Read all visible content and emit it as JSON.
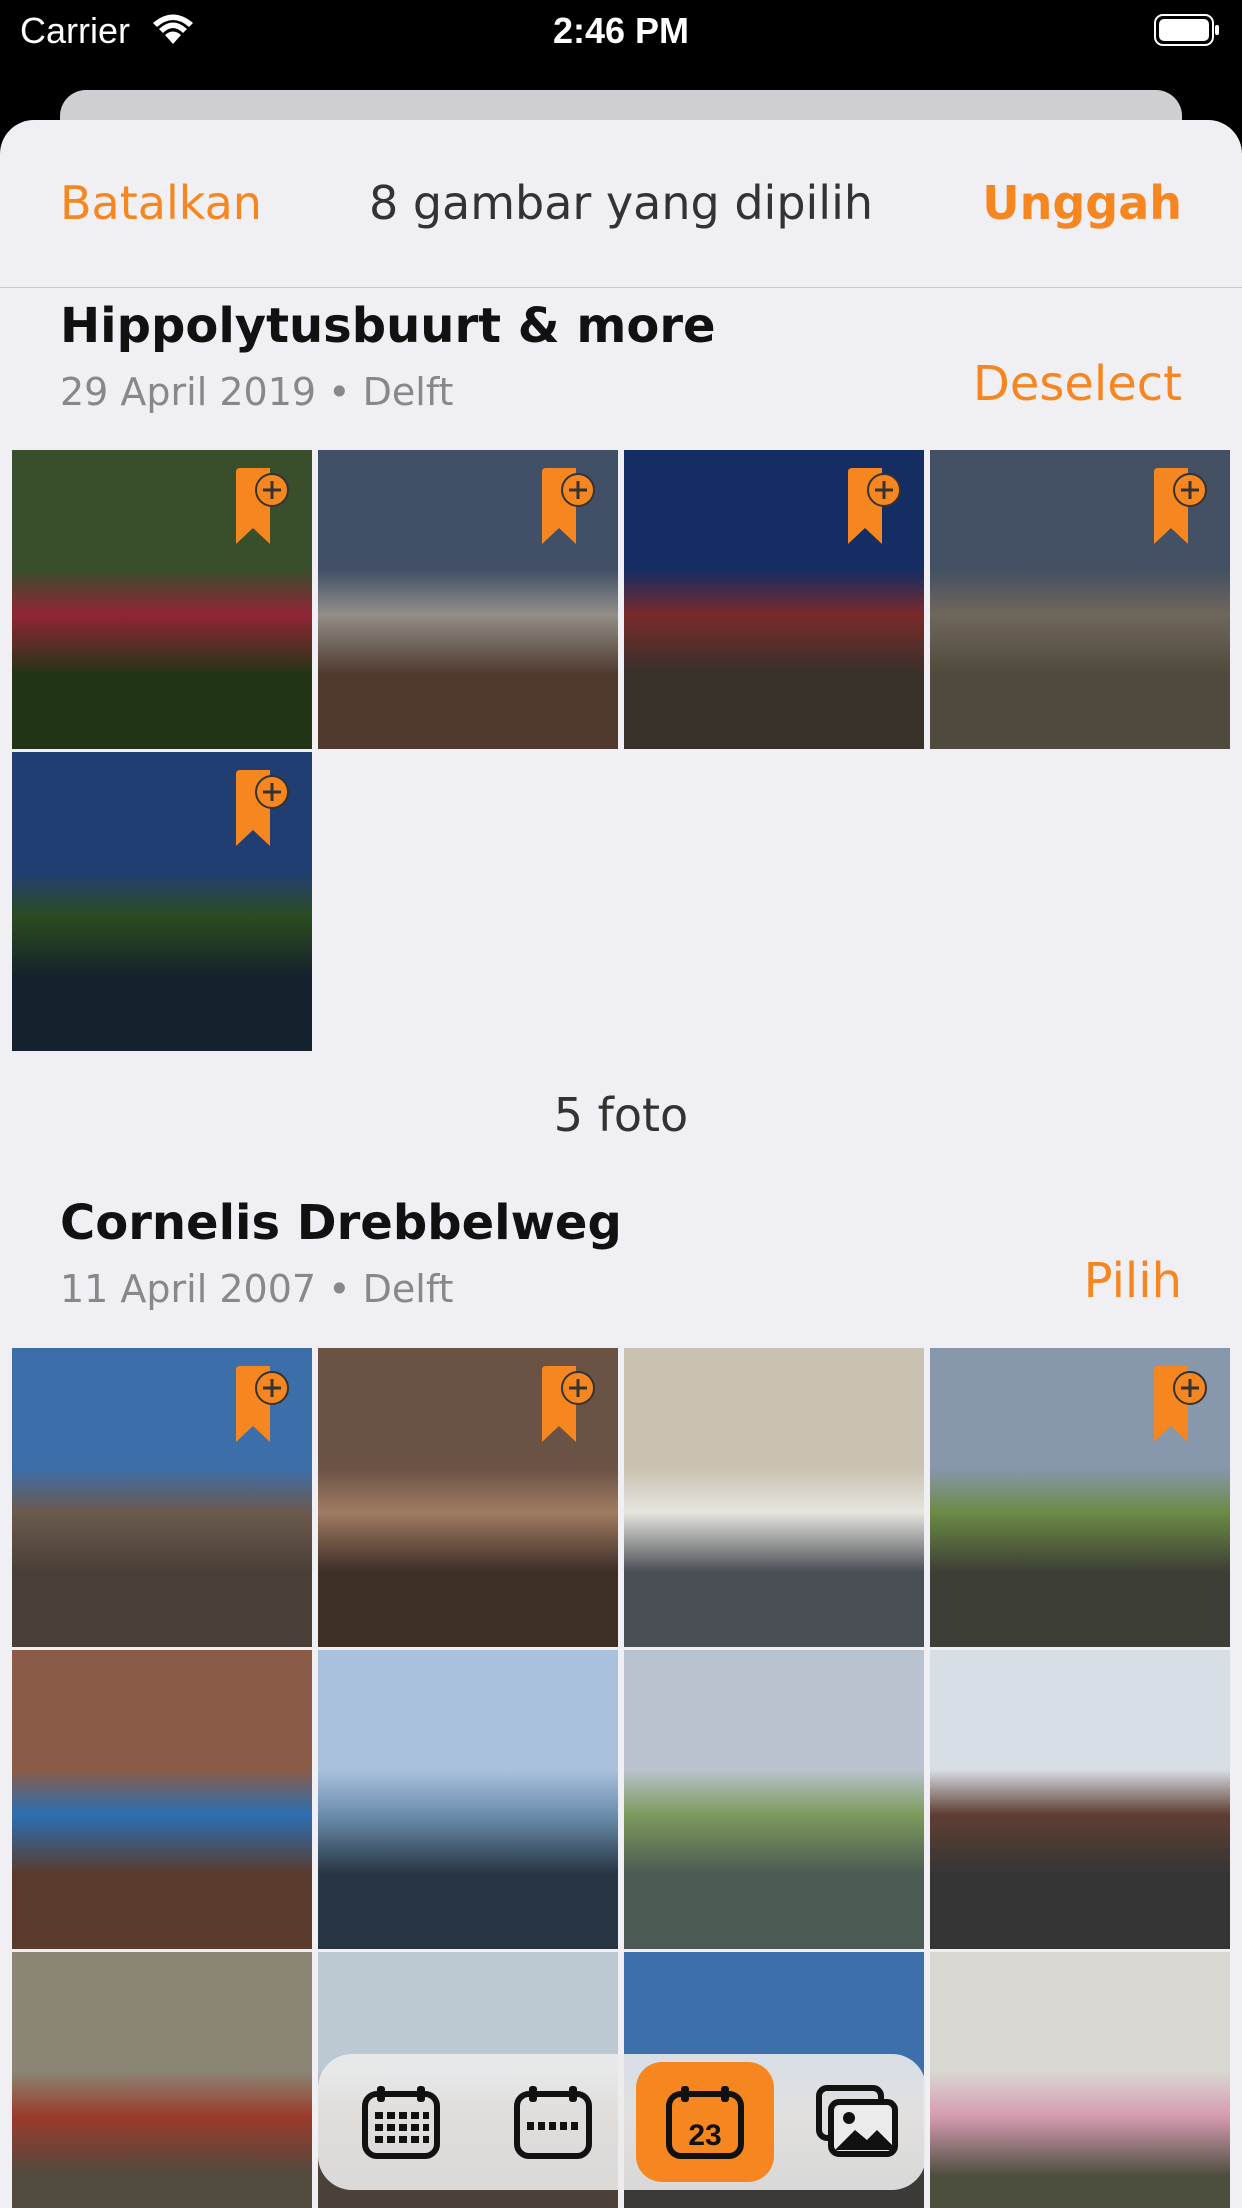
{
  "status": {
    "carrier": "Carrier",
    "time": "2:46 PM"
  },
  "nav": {
    "cancel": "Batalkan",
    "title": "8 gambar yang dipilih",
    "upload": "Unggah"
  },
  "sections": [
    {
      "title": "Hippolytusbuurt & more",
      "meta": "29 April 2019 • Delft",
      "action": "Deselect",
      "count": "5 foto",
      "photos": [
        {
          "selected": true,
          "sky": "#4f6c3c",
          "ground": "#2f4a1f",
          "accent": "#c9344b"
        },
        {
          "selected": true,
          "sky": "#5b6f8f",
          "ground": "#6f5140",
          "accent": "#cbc6bd"
        },
        {
          "selected": true,
          "sky": "#1d3f8a",
          "ground": "#4d443b",
          "accent": "#a93b3b"
        },
        {
          "selected": true,
          "sky": "#5f6f89",
          "ground": "#6f6756",
          "accent": "#9b8f80"
        },
        {
          "selected": true,
          "sky": "#2e56a0",
          "ground": "#1e2f3f",
          "accent": "#3c6a2c"
        }
      ]
    },
    {
      "title": "Cornelis Drebbelweg",
      "meta": "11 April 2007 • Delft",
      "action": "Pilih",
      "photos": [
        {
          "selected": false,
          "badge": true,
          "sky": "#3c6ea9",
          "ground": "#4a3f38",
          "accent": "#6b5a4d"
        },
        {
          "selected": false,
          "badge": true,
          "sky": "#6a5245",
          "ground": "#3d2e26",
          "accent": "#a07b62"
        },
        {
          "selected": false,
          "badge": false,
          "sky": "#c9c2b0",
          "ground": "#4a4e55",
          "accent": "#e6e4de"
        },
        {
          "selected": false,
          "badge": true,
          "sky": "#8797ac",
          "ground": "#3d3e36",
          "accent": "#6c8b45"
        },
        {
          "selected": false,
          "badge": false,
          "sky": "#8a5b46",
          "ground": "#5a3b2c",
          "accent": "#2c6fb2"
        },
        {
          "selected": false,
          "badge": false,
          "sky": "#a9c1dc",
          "ground": "#273543",
          "accent": "#6c8fae"
        },
        {
          "selected": false,
          "badge": false,
          "sky": "#b9c3cf",
          "ground": "#4b5a52",
          "accent": "#7d9a5c"
        },
        {
          "selected": false,
          "badge": false,
          "sky": "#d7dde5",
          "ground": "#353536",
          "accent": "#5f3f33"
        },
        {
          "selected": false,
          "badge": false,
          "sky": "#8a8575",
          "ground": "#504a3f",
          "accent": "#9a3b2a"
        },
        {
          "selected": false,
          "badge": false,
          "sky": "#bcc8d2",
          "ground": "#4c4138",
          "accent": "#7a5a44"
        },
        {
          "selected": false,
          "badge": false,
          "sky": "#3d6fab",
          "ground": "#3c3a36",
          "accent": "#8a7c6a"
        },
        {
          "selected": false,
          "badge": false,
          "sky": "#d9d7d2",
          "ground": "#4c4e3e",
          "accent": "#d59bb0"
        }
      ]
    }
  ],
  "tabs": [
    {
      "name": "calendar-year-icon",
      "active": false
    },
    {
      "name": "calendar-month-icon",
      "active": false
    },
    {
      "name": "calendar-day-icon",
      "label": "23",
      "active": true
    },
    {
      "name": "photos-icon",
      "active": false
    }
  ],
  "colors": {
    "accent": "#f6861f",
    "sheet": "#f0eff4"
  }
}
